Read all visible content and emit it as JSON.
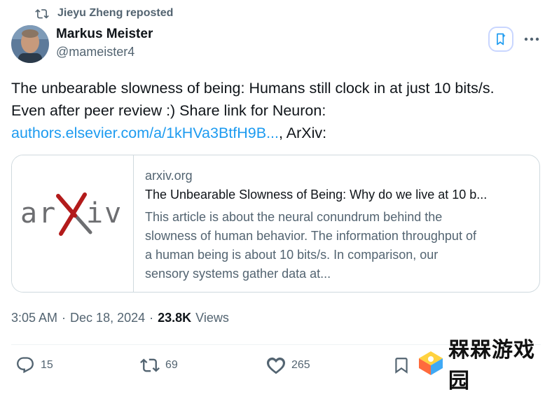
{
  "repost": {
    "label": "Jieyu Zheng reposted"
  },
  "author": {
    "name": "Markus Meister",
    "handle": "@mameister4"
  },
  "tweet": {
    "line1": "The unbearable slowness of being: Humans still clock in at just 10 bits/s.",
    "line2": "Even after peer review :) Share link for Neuron:",
    "link": "authors.elsevier.com/a/1kHVa3BtfH9B...",
    "after_link": ", ArXiv:"
  },
  "card": {
    "logo_text": "arXiv",
    "domain": "arxiv.org",
    "title": "The Unbearable Slowness of Being: Why do we live at 10 b...",
    "description_lines": [
      "This article is about the neural conundrum behind the",
      "slowness of human behavior. The information throughput of",
      "a human being is about 10 bits/s. In comparison, our",
      "sensory systems gather data at..."
    ]
  },
  "meta": {
    "time": "3:05 AM",
    "sep1": "·",
    "date": "Dec 18, 2024",
    "sep2": "·",
    "views_count": "23.8K",
    "views_label": "Views"
  },
  "actions": {
    "replies": "15",
    "reposts": "69",
    "likes": "265"
  },
  "watermark": {
    "text": "槑槑游戏园"
  },
  "colors": {
    "link": "#1d9bf0",
    "muted": "#536471",
    "arxiv_red": "#b31b1b",
    "arxiv_gray": "#6d6e71",
    "repost_green": "#00ba7c"
  },
  "icons": [
    "repost-icon",
    "avatar",
    "grok-icon",
    "more-icon",
    "reply-icon",
    "retweet-icon",
    "like-icon",
    "bookmark-icon",
    "watermark-logo"
  ]
}
